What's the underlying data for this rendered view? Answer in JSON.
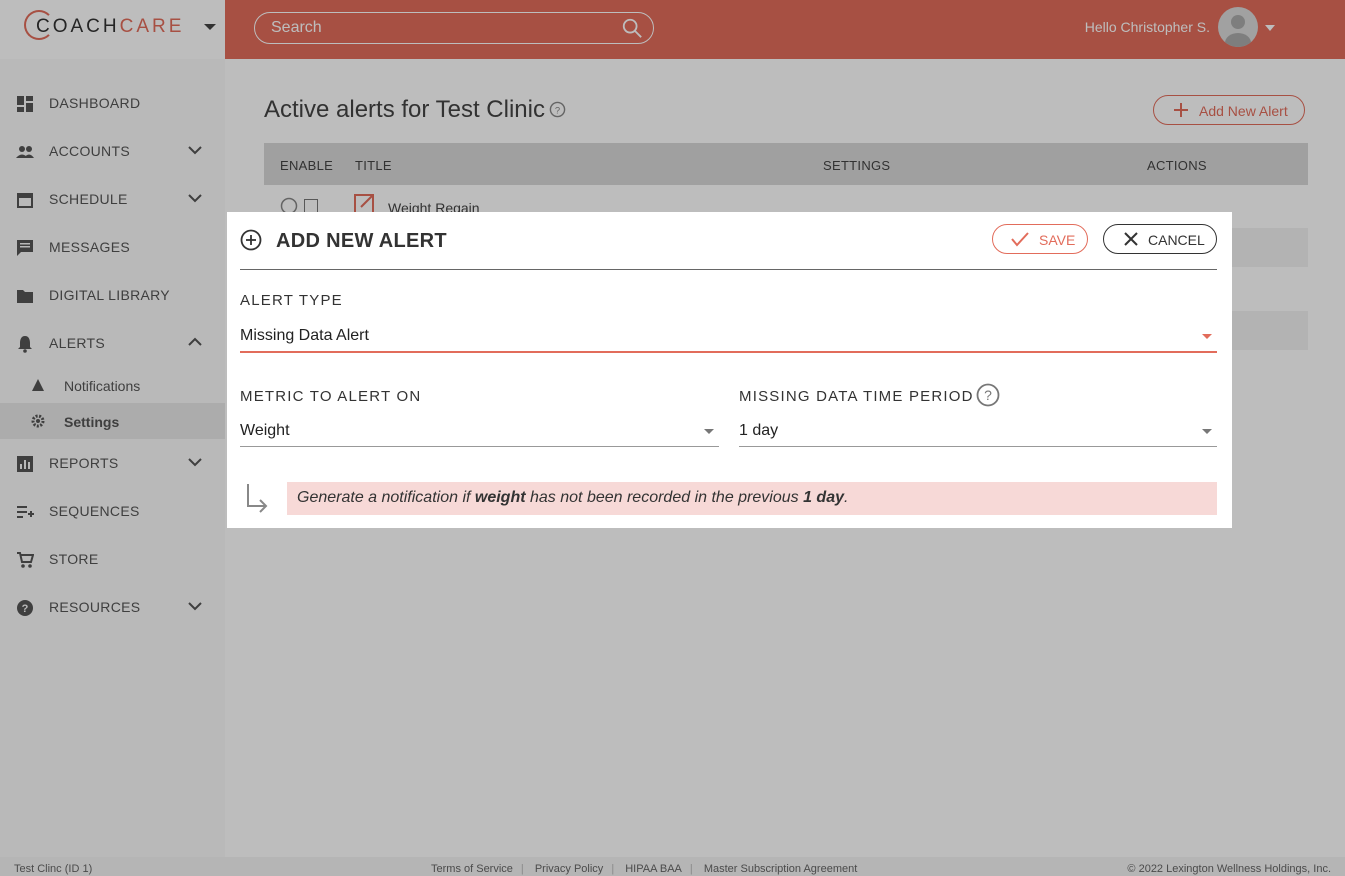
{
  "brand": {
    "logo_prefix": "COACH",
    "logo_suffix": "CARE"
  },
  "header": {
    "search_placeholder": "Search",
    "greeting": "Hello Christopher S."
  },
  "sidebar": {
    "items": [
      {
        "label": "DASHBOARD",
        "icon": "dashboard-icon"
      },
      {
        "label": "ACCOUNTS",
        "icon": "people-icon"
      },
      {
        "label": "SCHEDULE",
        "icon": "calendar-icon"
      },
      {
        "label": "MESSAGES",
        "icon": "message-icon"
      },
      {
        "label": "DIGITAL LIBRARY",
        "icon": "folder-icon"
      },
      {
        "label": "ALERTS",
        "icon": "bell-icon"
      },
      {
        "label": "REPORTS",
        "icon": "chart-icon"
      },
      {
        "label": "SEQUENCES",
        "icon": "playlist-icon"
      },
      {
        "label": "STORE",
        "icon": "cart-icon"
      },
      {
        "label": "RESOURCES",
        "icon": "help-circle-icon"
      }
    ],
    "sub_items": [
      {
        "label": "Notifications",
        "icon": "warning-icon"
      },
      {
        "label": "Settings",
        "icon": "gear-icon"
      }
    ]
  },
  "page": {
    "title": "Active alerts for Test Clinic",
    "add_button": "Add New Alert",
    "columns": [
      "ENABLE",
      "TITLE",
      "SETTINGS",
      "ACTIONS"
    ],
    "first_row_title": "Weight Regain"
  },
  "modal": {
    "title": "ADD NEW ALERT",
    "save_label": "SAVE",
    "cancel_label": "CANCEL",
    "alert_type_label": "ALERT TYPE",
    "alert_type_value": "Missing Data Alert",
    "metric_label": "METRIC TO ALERT ON",
    "metric_value": "Weight",
    "period_label": "MISSING DATA TIME PERIOD",
    "period_value": "1 day",
    "summary": {
      "prefix": "Generate a notification if ",
      "metric": "weight",
      "middle": " has not been recorded in the previous ",
      "period": "1 day",
      "suffix": "."
    }
  },
  "footer": {
    "clinic": "Test Clinc (ID 1)",
    "links": [
      "Terms of Service",
      "Privacy Policy",
      "HIPAA BAA",
      "Master Subscription Agreement"
    ],
    "copyright": "© 2022 Lexington Wellness Holdings, Inc."
  },
  "colors": {
    "accent": "#e26c5b",
    "summary_bg": "#f7d9d7"
  }
}
